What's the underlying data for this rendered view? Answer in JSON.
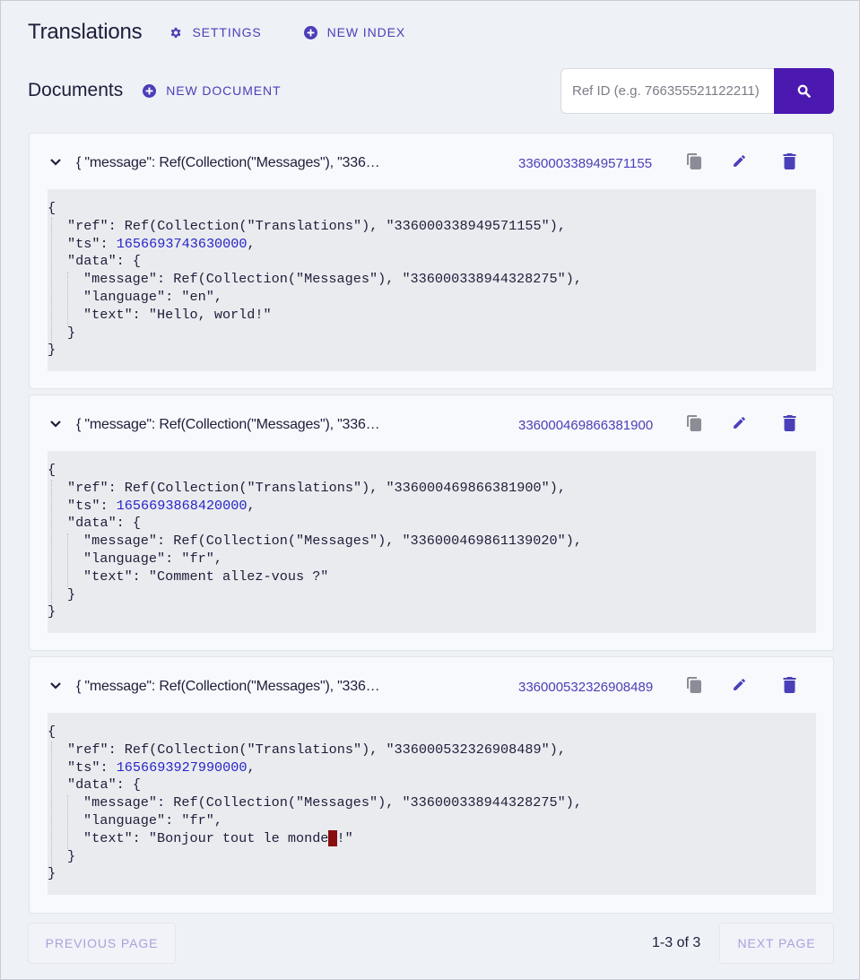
{
  "header": {
    "title": "Translations",
    "settings_label": "SETTINGS",
    "new_index_label": "NEW INDEX"
  },
  "documents_section": {
    "title": "Documents",
    "new_document_label": "NEW DOCUMENT"
  },
  "search": {
    "placeholder": "Ref ID (e.g. 766355521122211)"
  },
  "documents": [
    {
      "preview": "{ \"message\": Ref(Collection(\"Messages\"), \"336…",
      "ref_id": "336000338949571155",
      "code": {
        "open": "{",
        "ref_key": "\"ref\": Ref(Collection(\"Translations\"), \"336000338949571155\"),",
        "ts_key": "\"ts\": ",
        "ts_value": "1656693743630000",
        "data_open": "\"data\": {",
        "message": "\"message\": Ref(Collection(\"Messages\"), \"336000338944328275\"),",
        "language": "\"language\": \"en\",",
        "text": "\"text\": \"Hello, world!\"",
        "data_close": "}",
        "close": "}"
      }
    },
    {
      "preview": "{ \"message\": Ref(Collection(\"Messages\"), \"336…",
      "ref_id": "336000469866381900",
      "code": {
        "open": "{",
        "ref_key": "\"ref\": Ref(Collection(\"Translations\"), \"336000469866381900\"),",
        "ts_key": "\"ts\": ",
        "ts_value": "1656693868420000",
        "data_open": "\"data\": {",
        "message": "\"message\": Ref(Collection(\"Messages\"), \"336000469861139020\"),",
        "language": "\"language\": \"fr\",",
        "text": "\"text\": \"Comment allez-vous ?\"",
        "data_close": "}",
        "close": "}"
      }
    },
    {
      "preview": "{ \"message\": Ref(Collection(\"Messages\"), \"336…",
      "ref_id": "336000532326908489",
      "code": {
        "open": "{",
        "ref_key": "\"ref\": Ref(Collection(\"Translations\"), \"336000532326908489\"),",
        "ts_key": "\"ts\": ",
        "ts_value": "1656693927990000",
        "data_open": "\"data\": {",
        "message": "\"message\": Ref(Collection(\"Messages\"), \"336000338944328275\"),",
        "language": "\"language\": \"fr\",",
        "text_before": "\"text\": \"Bonjour tout le monde",
        "text_cursor": " ",
        "text_after": "!\"",
        "data_close": "}",
        "close": "}"
      }
    }
  ],
  "pagination": {
    "previous_label": "PREVIOUS PAGE",
    "count": "1-3 of 3",
    "next_label": "NEXT PAGE"
  },
  "colors": {
    "accent": "#4b3fb8",
    "search_button": "#4b19b0",
    "number": "#2626c8",
    "cursor": "#8a0d0d"
  }
}
